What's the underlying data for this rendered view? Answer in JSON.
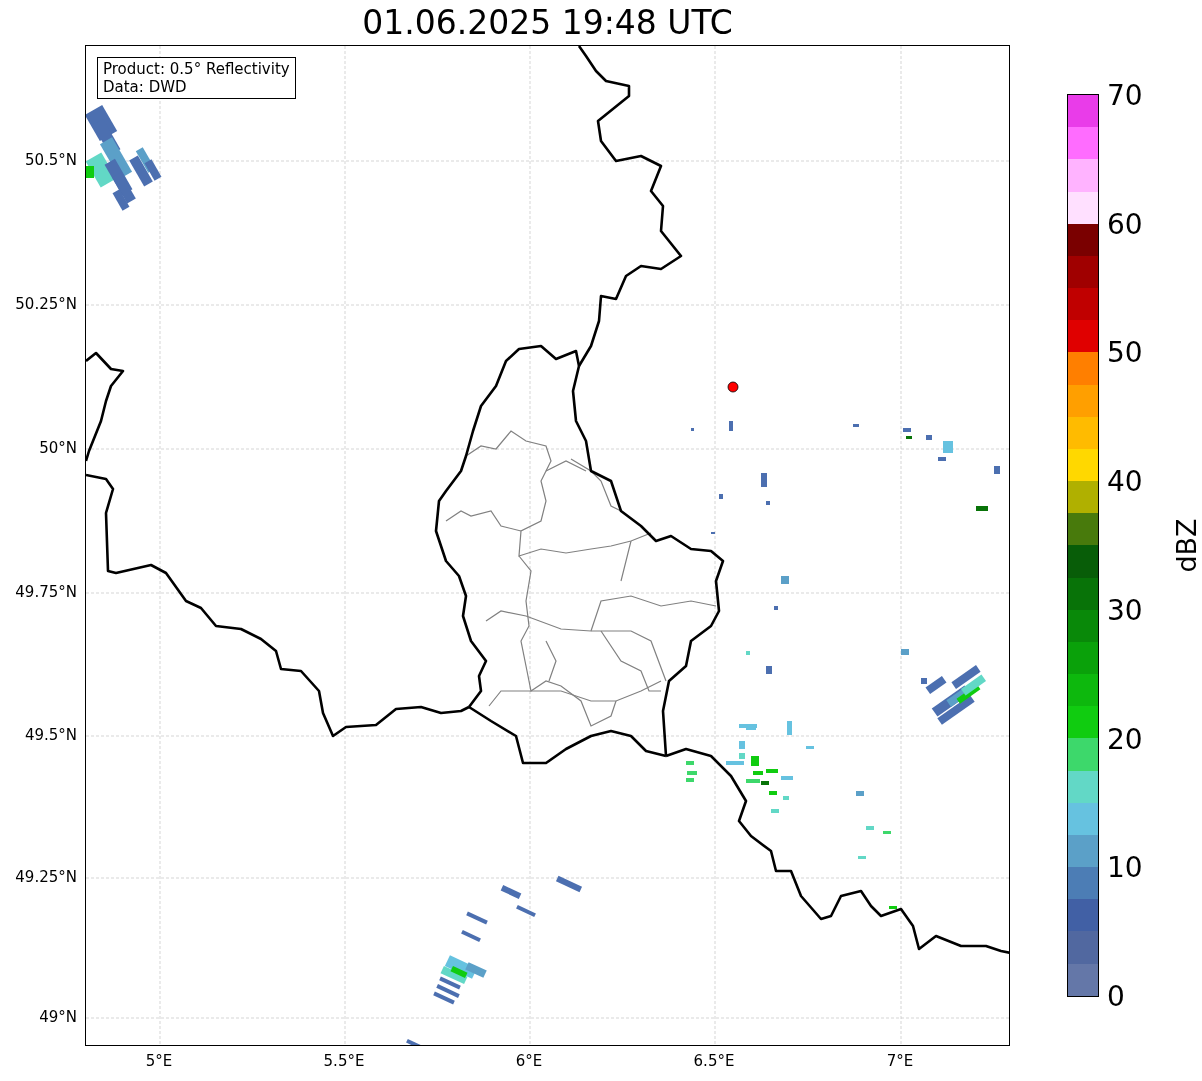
{
  "title": "01.06.2025 19:48 UTC",
  "info_box": {
    "lines": [
      "Product: 0.5° Reflectivity",
      "Data: DWD"
    ]
  },
  "y_axis": {
    "ticks": [
      "50.5°N",
      "50.25°N",
      "50°N",
      "49.75°N",
      "49.5°N",
      "49.25°N",
      "49°N"
    ]
  },
  "x_axis": {
    "ticks": [
      "5°E",
      "5.5°E",
      "6°E",
      "6.5°E",
      "7°E"
    ]
  },
  "colorbar": {
    "label": "dBZ",
    "ticks": [
      "70",
      "60",
      "50",
      "40",
      "30",
      "20",
      "10",
      "0"
    ],
    "bins": [
      {
        "color": "#e93ce9"
      },
      {
        "color": "#ff6cff"
      },
      {
        "color": "#ffb3ff"
      },
      {
        "color": "#ffe0ff"
      },
      {
        "color": "#7a0000"
      },
      {
        "color": "#a00000"
      },
      {
        "color": "#c00000"
      },
      {
        "color": "#e00000"
      },
      {
        "color": "#ff7f00"
      },
      {
        "color": "#ff9f00"
      },
      {
        "color": "#ffbb00"
      },
      {
        "color": "#ffd800"
      },
      {
        "color": "#b0b000"
      },
      {
        "color": "#487a0c"
      },
      {
        "color": "#085d08"
      },
      {
        "color": "#087308"
      },
      {
        "color": "#098909"
      },
      {
        "color": "#0aa10a"
      },
      {
        "color": "#0db80d"
      },
      {
        "color": "#10cc10"
      },
      {
        "color": "#3dd86b"
      },
      {
        "color": "#62d8c6"
      },
      {
        "color": "#66c2e0"
      },
      {
        "color": "#5ba0c8"
      },
      {
        "color": "#4c7db5"
      },
      {
        "color": "#4160a5"
      },
      {
        "color": "#5168a0"
      },
      {
        "color": "#6477a8"
      }
    ]
  }
}
